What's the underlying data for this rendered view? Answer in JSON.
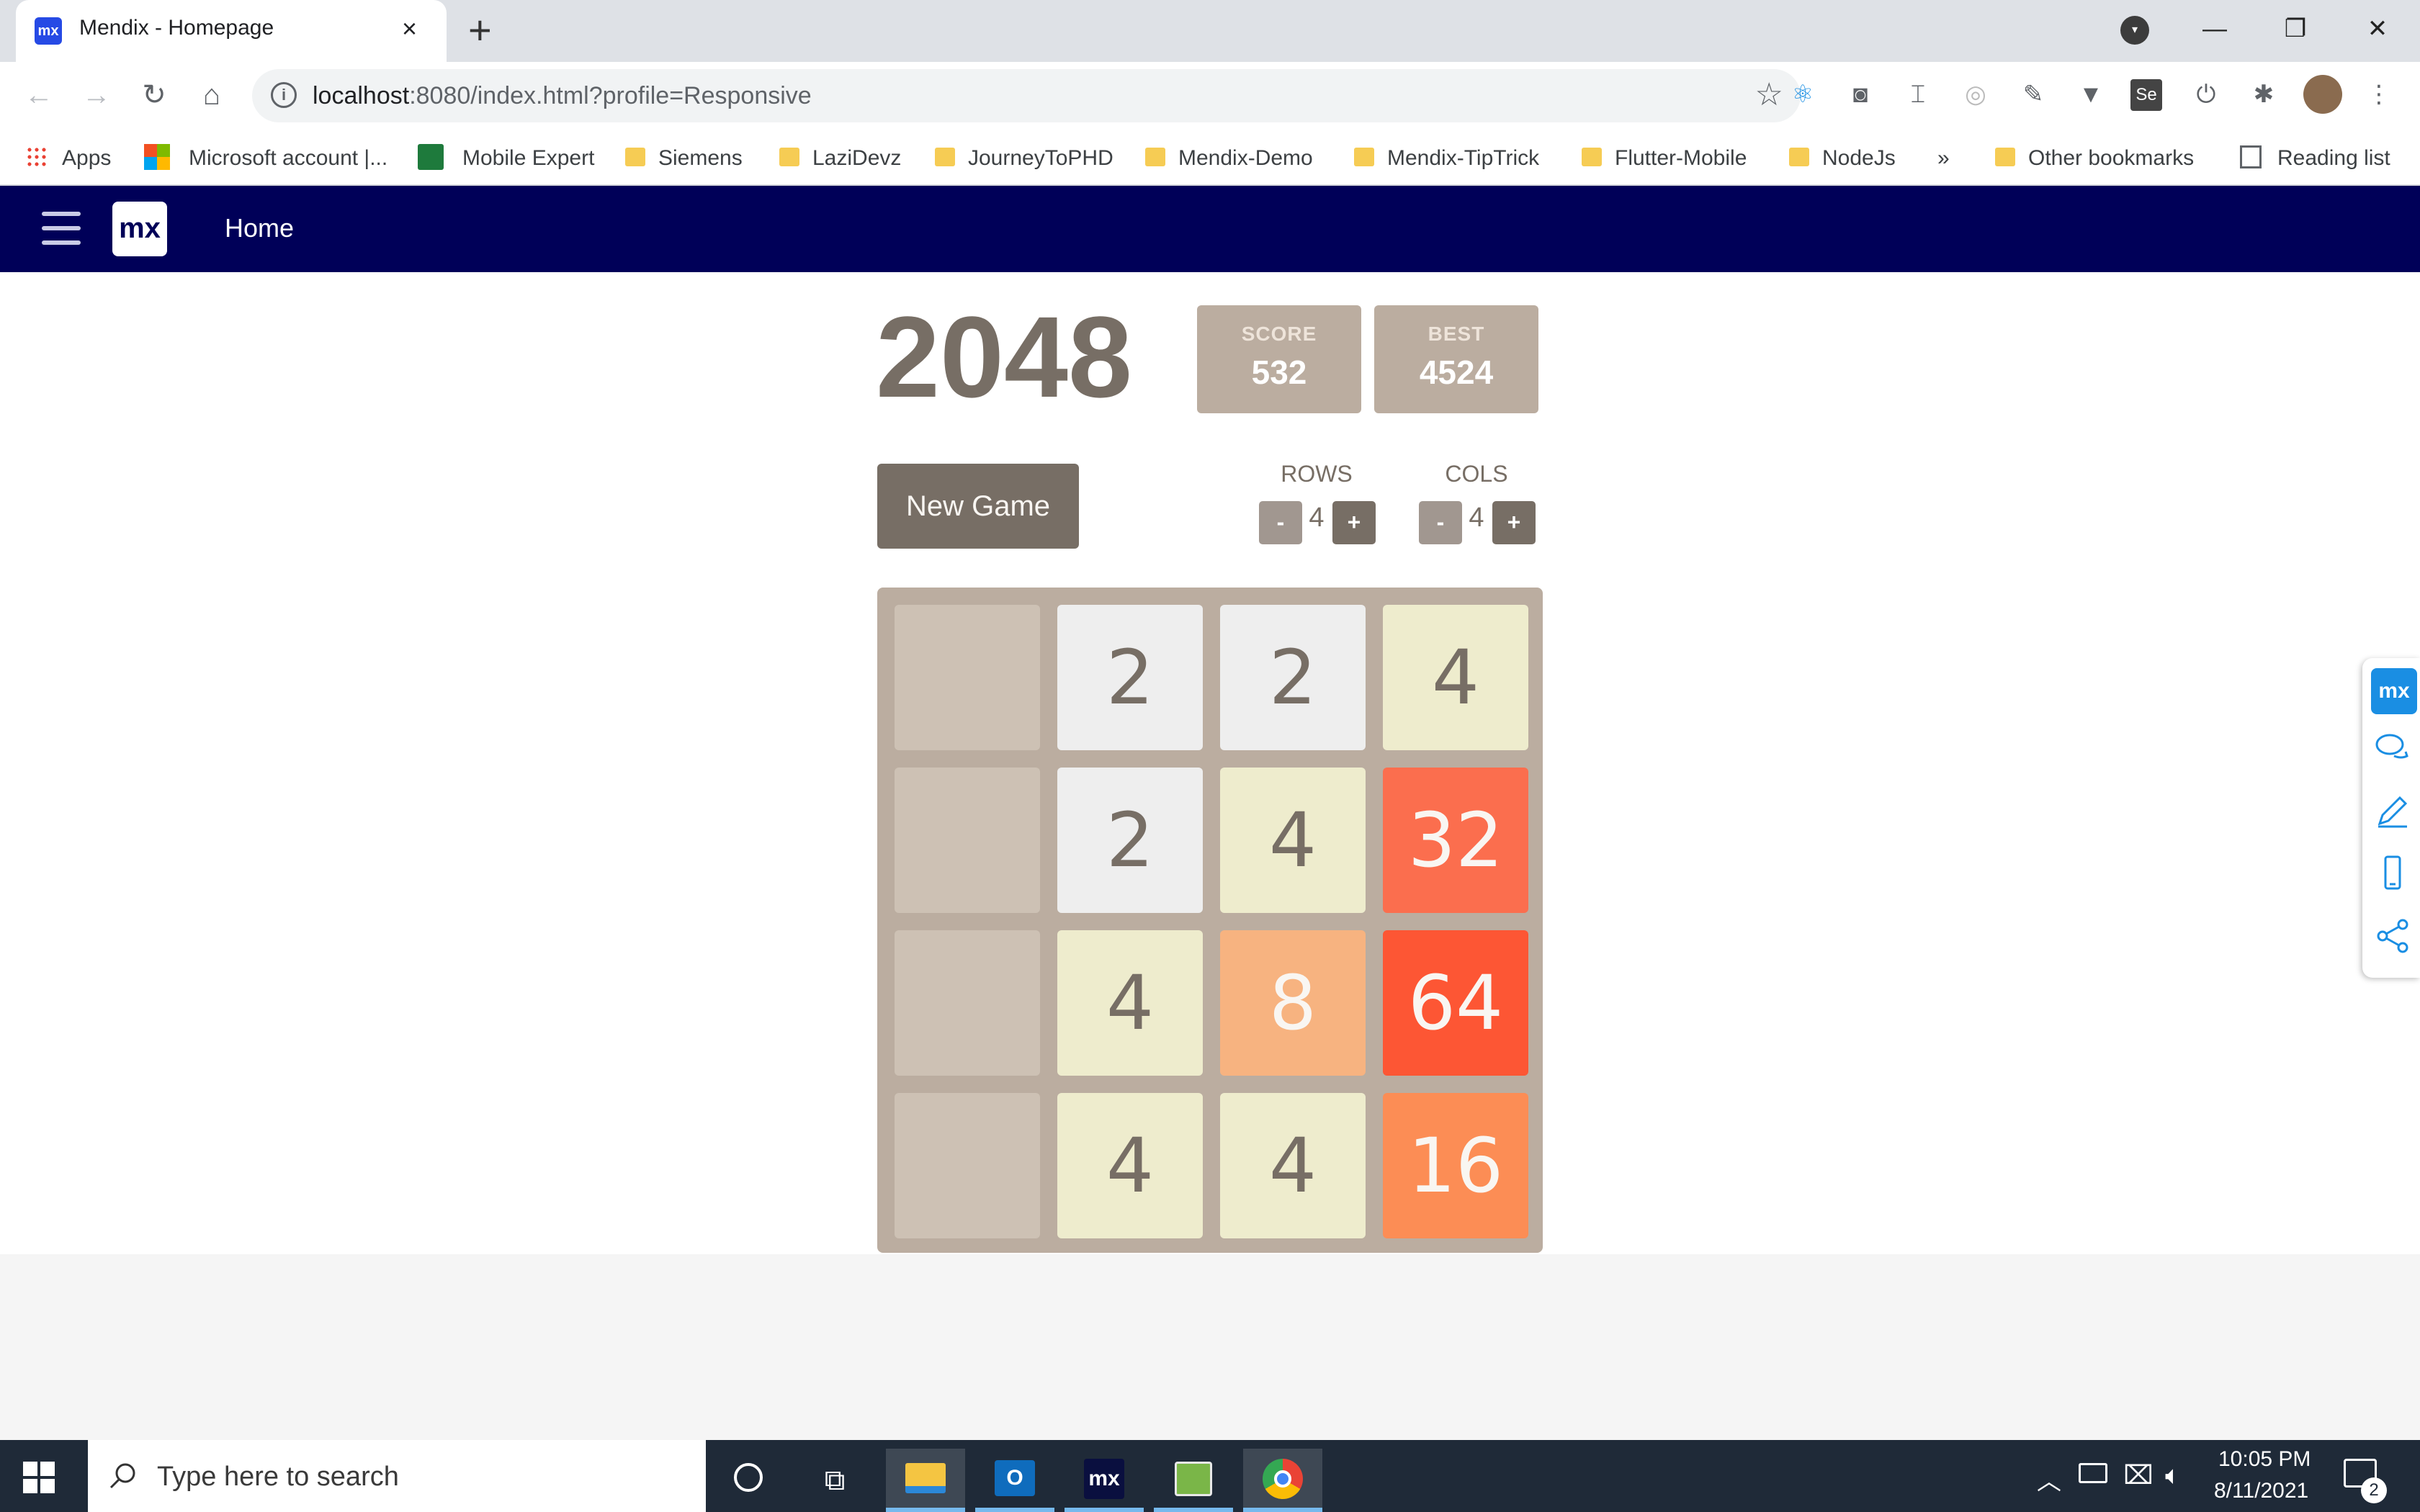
{
  "browser": {
    "tab_title": "Mendix - Homepage",
    "tab_favicon": "mx",
    "tab_close": "×",
    "new_tab": "+",
    "url_host": "localhost",
    "url_rest": ":8080/index.html?profile=Responsive",
    "bookmarks": [
      {
        "label": "Apps",
        "icon": "apps-grid-icon"
      },
      {
        "label": "Microsoft account |...",
        "icon": "microsoft-icon"
      },
      {
        "label": "Mobile Expert",
        "icon": "mobile-expert-icon"
      },
      {
        "label": "Siemens",
        "icon": "folder-icon"
      },
      {
        "label": "LaziDevz",
        "icon": "folder-icon"
      },
      {
        "label": "JourneyToPHD",
        "icon": "folder-icon"
      },
      {
        "label": "Mendix-Demo",
        "icon": "folder-icon"
      },
      {
        "label": "Mendix-TipTrick",
        "icon": "folder-icon"
      },
      {
        "label": "Flutter-Mobile",
        "icon": "folder-icon"
      },
      {
        "label": "NodeJs",
        "icon": "folder-icon"
      }
    ],
    "bookmarks_overflow": "»",
    "other_bookmarks": "Other bookmarks",
    "reading_list": "Reading list"
  },
  "app": {
    "logo": "mx",
    "nav_home": "Home"
  },
  "game": {
    "title": "2048",
    "score_label": "SCORE",
    "score_value": "532",
    "best_label": "BEST",
    "best_value": "4524",
    "new_game_label": "New Game",
    "rows_label": "ROWS",
    "rows_value": "4",
    "cols_label": "COLS",
    "cols_value": "4",
    "minus": "-",
    "plus": "+",
    "board": [
      [
        "",
        "2",
        "2",
        "4"
      ],
      [
        "",
        "2",
        "4",
        "32"
      ],
      [
        "",
        "4",
        "8",
        "64"
      ],
      [
        "",
        "4",
        "4",
        "16"
      ]
    ],
    "tile_colors": {
      "empty": "#cdc1b4",
      "2": "#eeeeee",
      "4": "#eeeccd",
      "8": "#f7b380",
      "16": "#fc8d55",
      "32": "#fb6e4e",
      "64": "#fd5634"
    }
  },
  "side_panel": {
    "logo": "mx"
  },
  "taskbar": {
    "search_placeholder": "Type here to search",
    "time": "10:05 PM",
    "date": "8/11/2021",
    "notifications": "2"
  }
}
